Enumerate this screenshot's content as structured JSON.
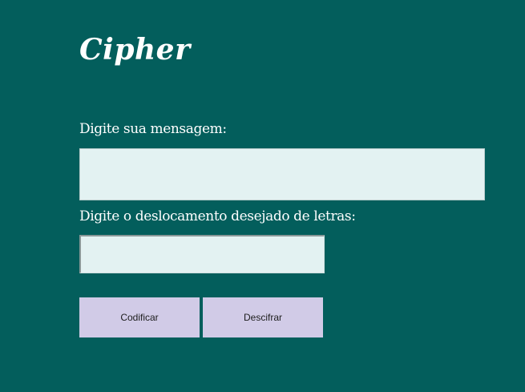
{
  "app": {
    "title": "Cipher",
    "background_color": "#035e5c",
    "input_color": "#e3f2f2",
    "button_color": "#d1cbe7"
  },
  "form": {
    "message_label": "Digite sua mensagem:",
    "message_value": "",
    "shift_label": "Digite o deslocamento desejado de letras:",
    "shift_value": "",
    "encode_label": "Codificar",
    "decode_label": "Descifrar"
  }
}
